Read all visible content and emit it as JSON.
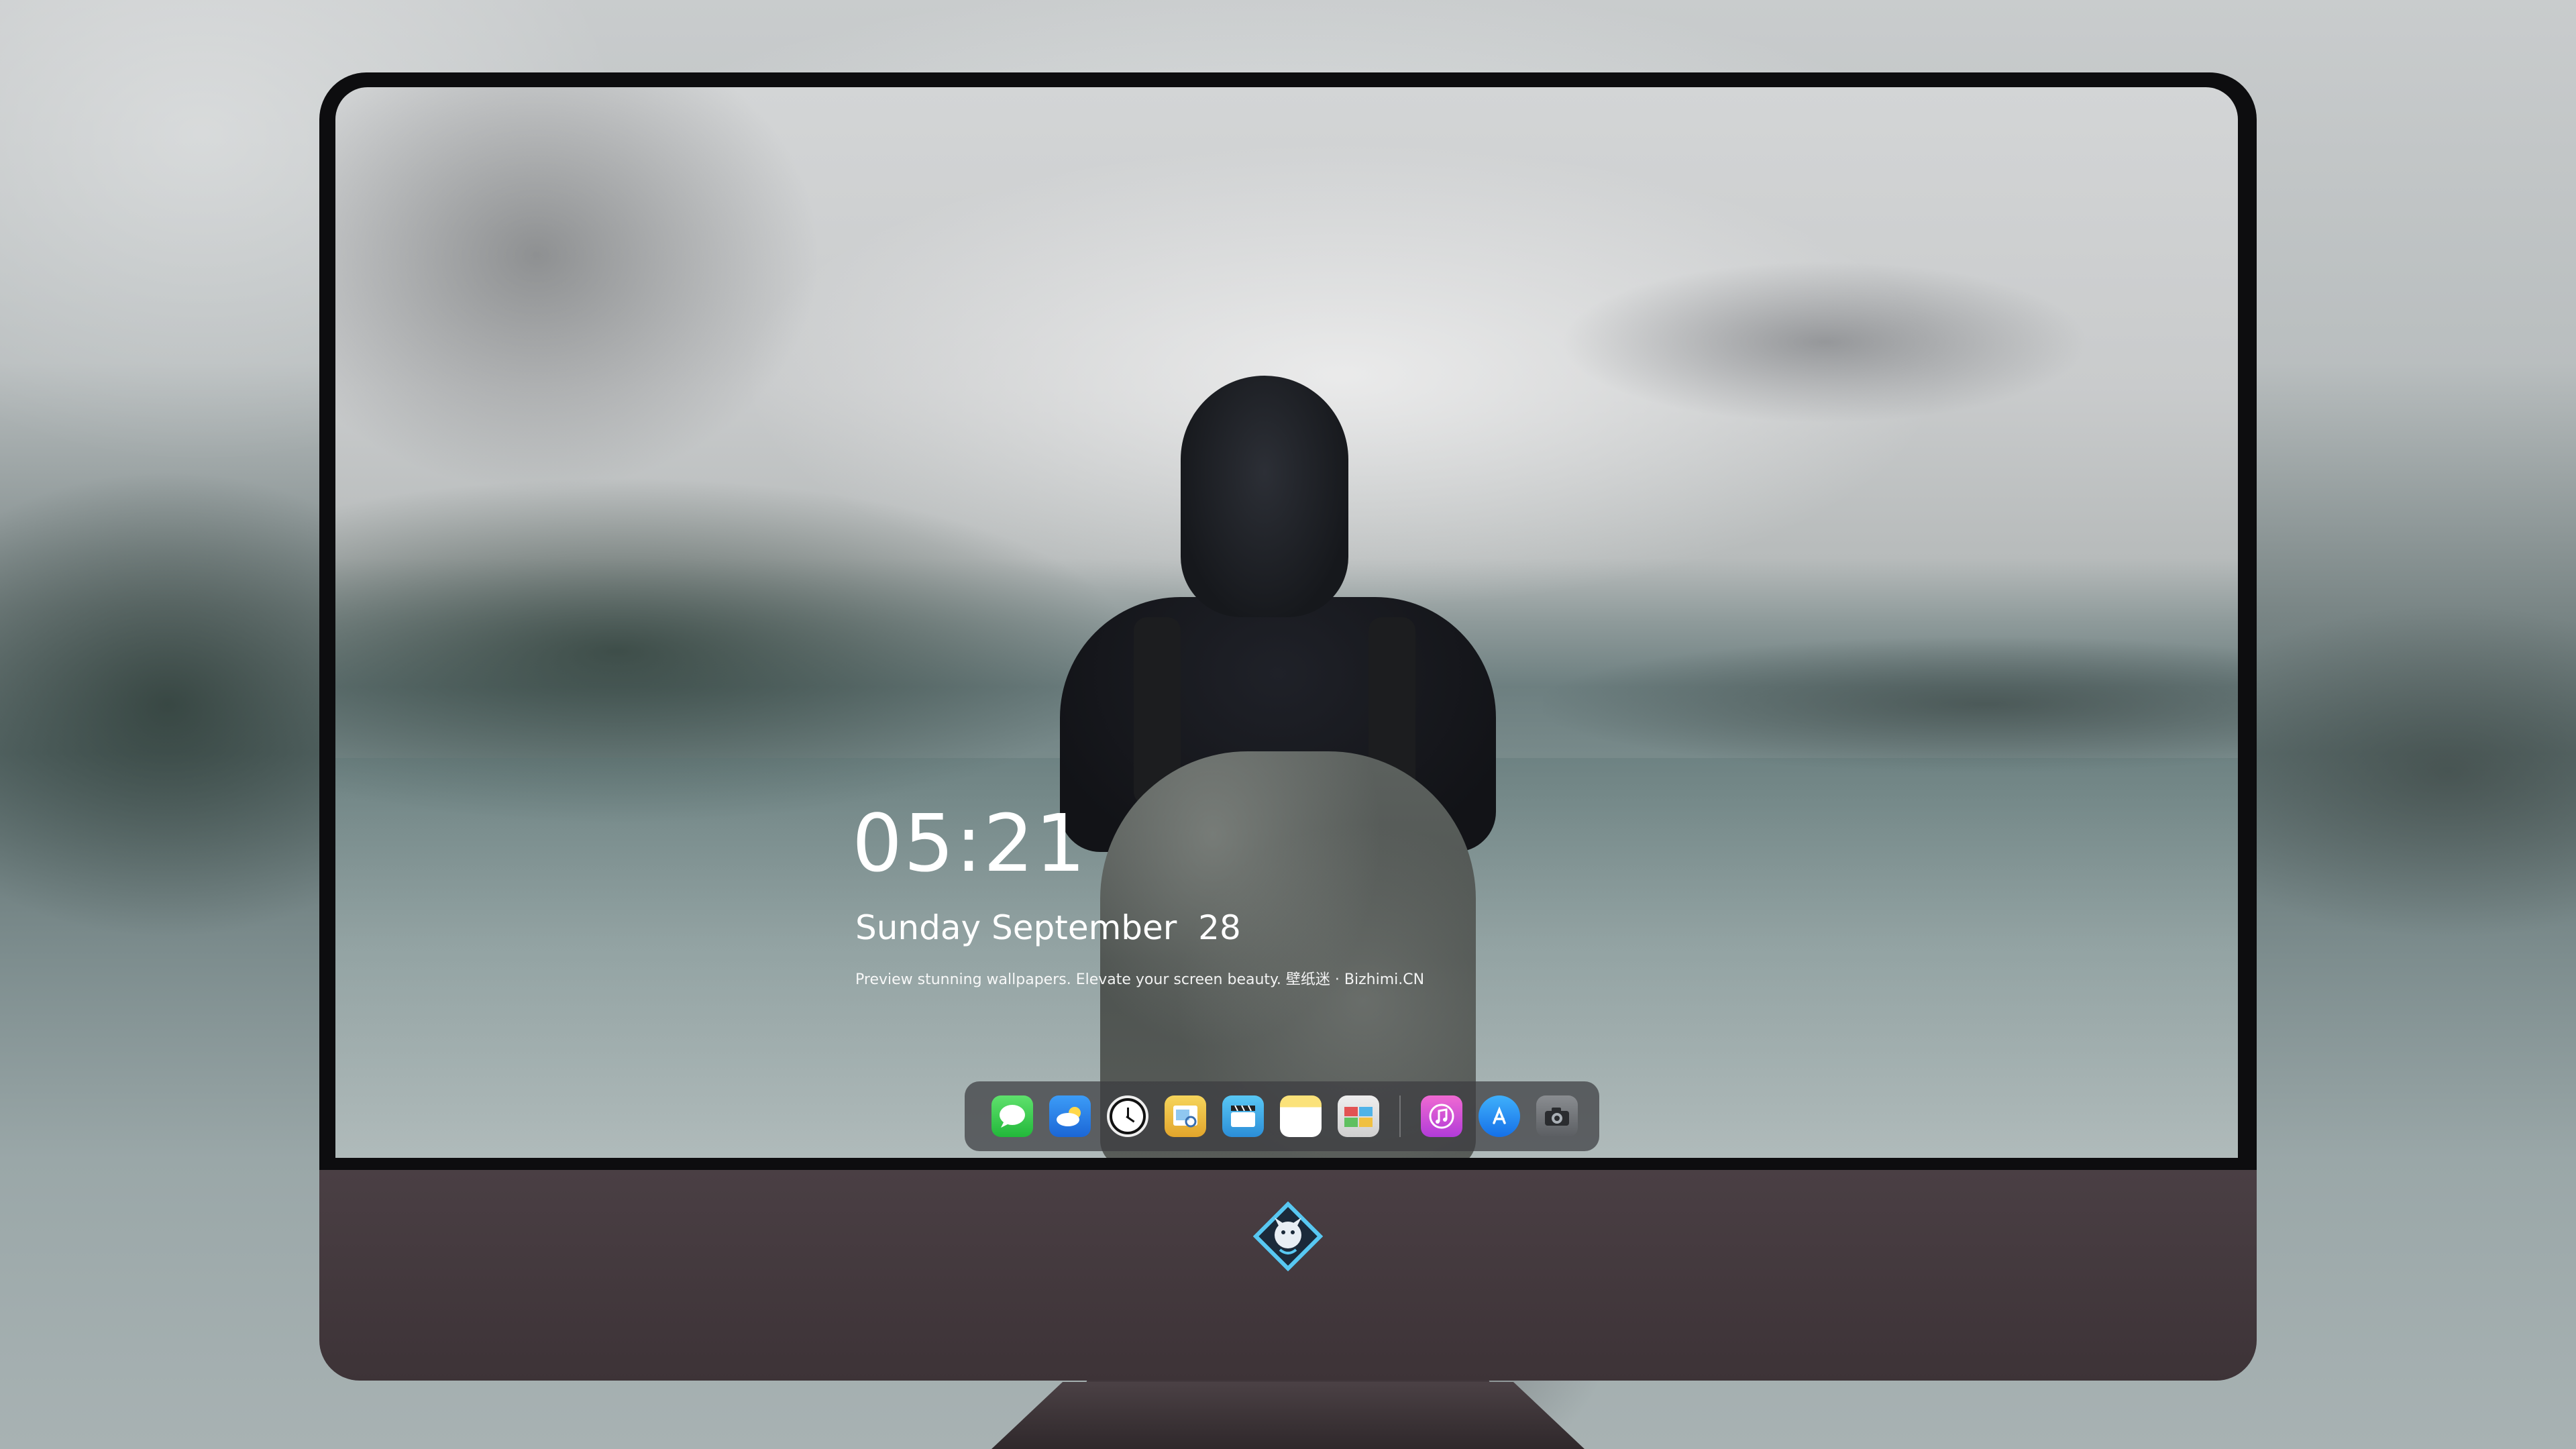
{
  "lock_screen": {
    "time": "05:21",
    "date": "Sunday September  28",
    "tagline": "Preview stunning wallpapers. Elevate your screen beauty. 壁纸迷 · Bizhimi.CN"
  },
  "dock": {
    "apps": [
      {
        "name": "messages-icon"
      },
      {
        "name": "weather-icon"
      },
      {
        "name": "clock-icon"
      },
      {
        "name": "preview-icon"
      },
      {
        "name": "clips-icon"
      },
      {
        "name": "notes-icon"
      },
      {
        "name": "photo-booth-icon"
      },
      {
        "name": "itunes-icon"
      },
      {
        "name": "app-store-icon"
      },
      {
        "name": "camera-icon"
      }
    ]
  },
  "colors": {
    "chin": "#4a3f44",
    "bezel": "#0d0d0f",
    "dock": "#3c3c40"
  }
}
